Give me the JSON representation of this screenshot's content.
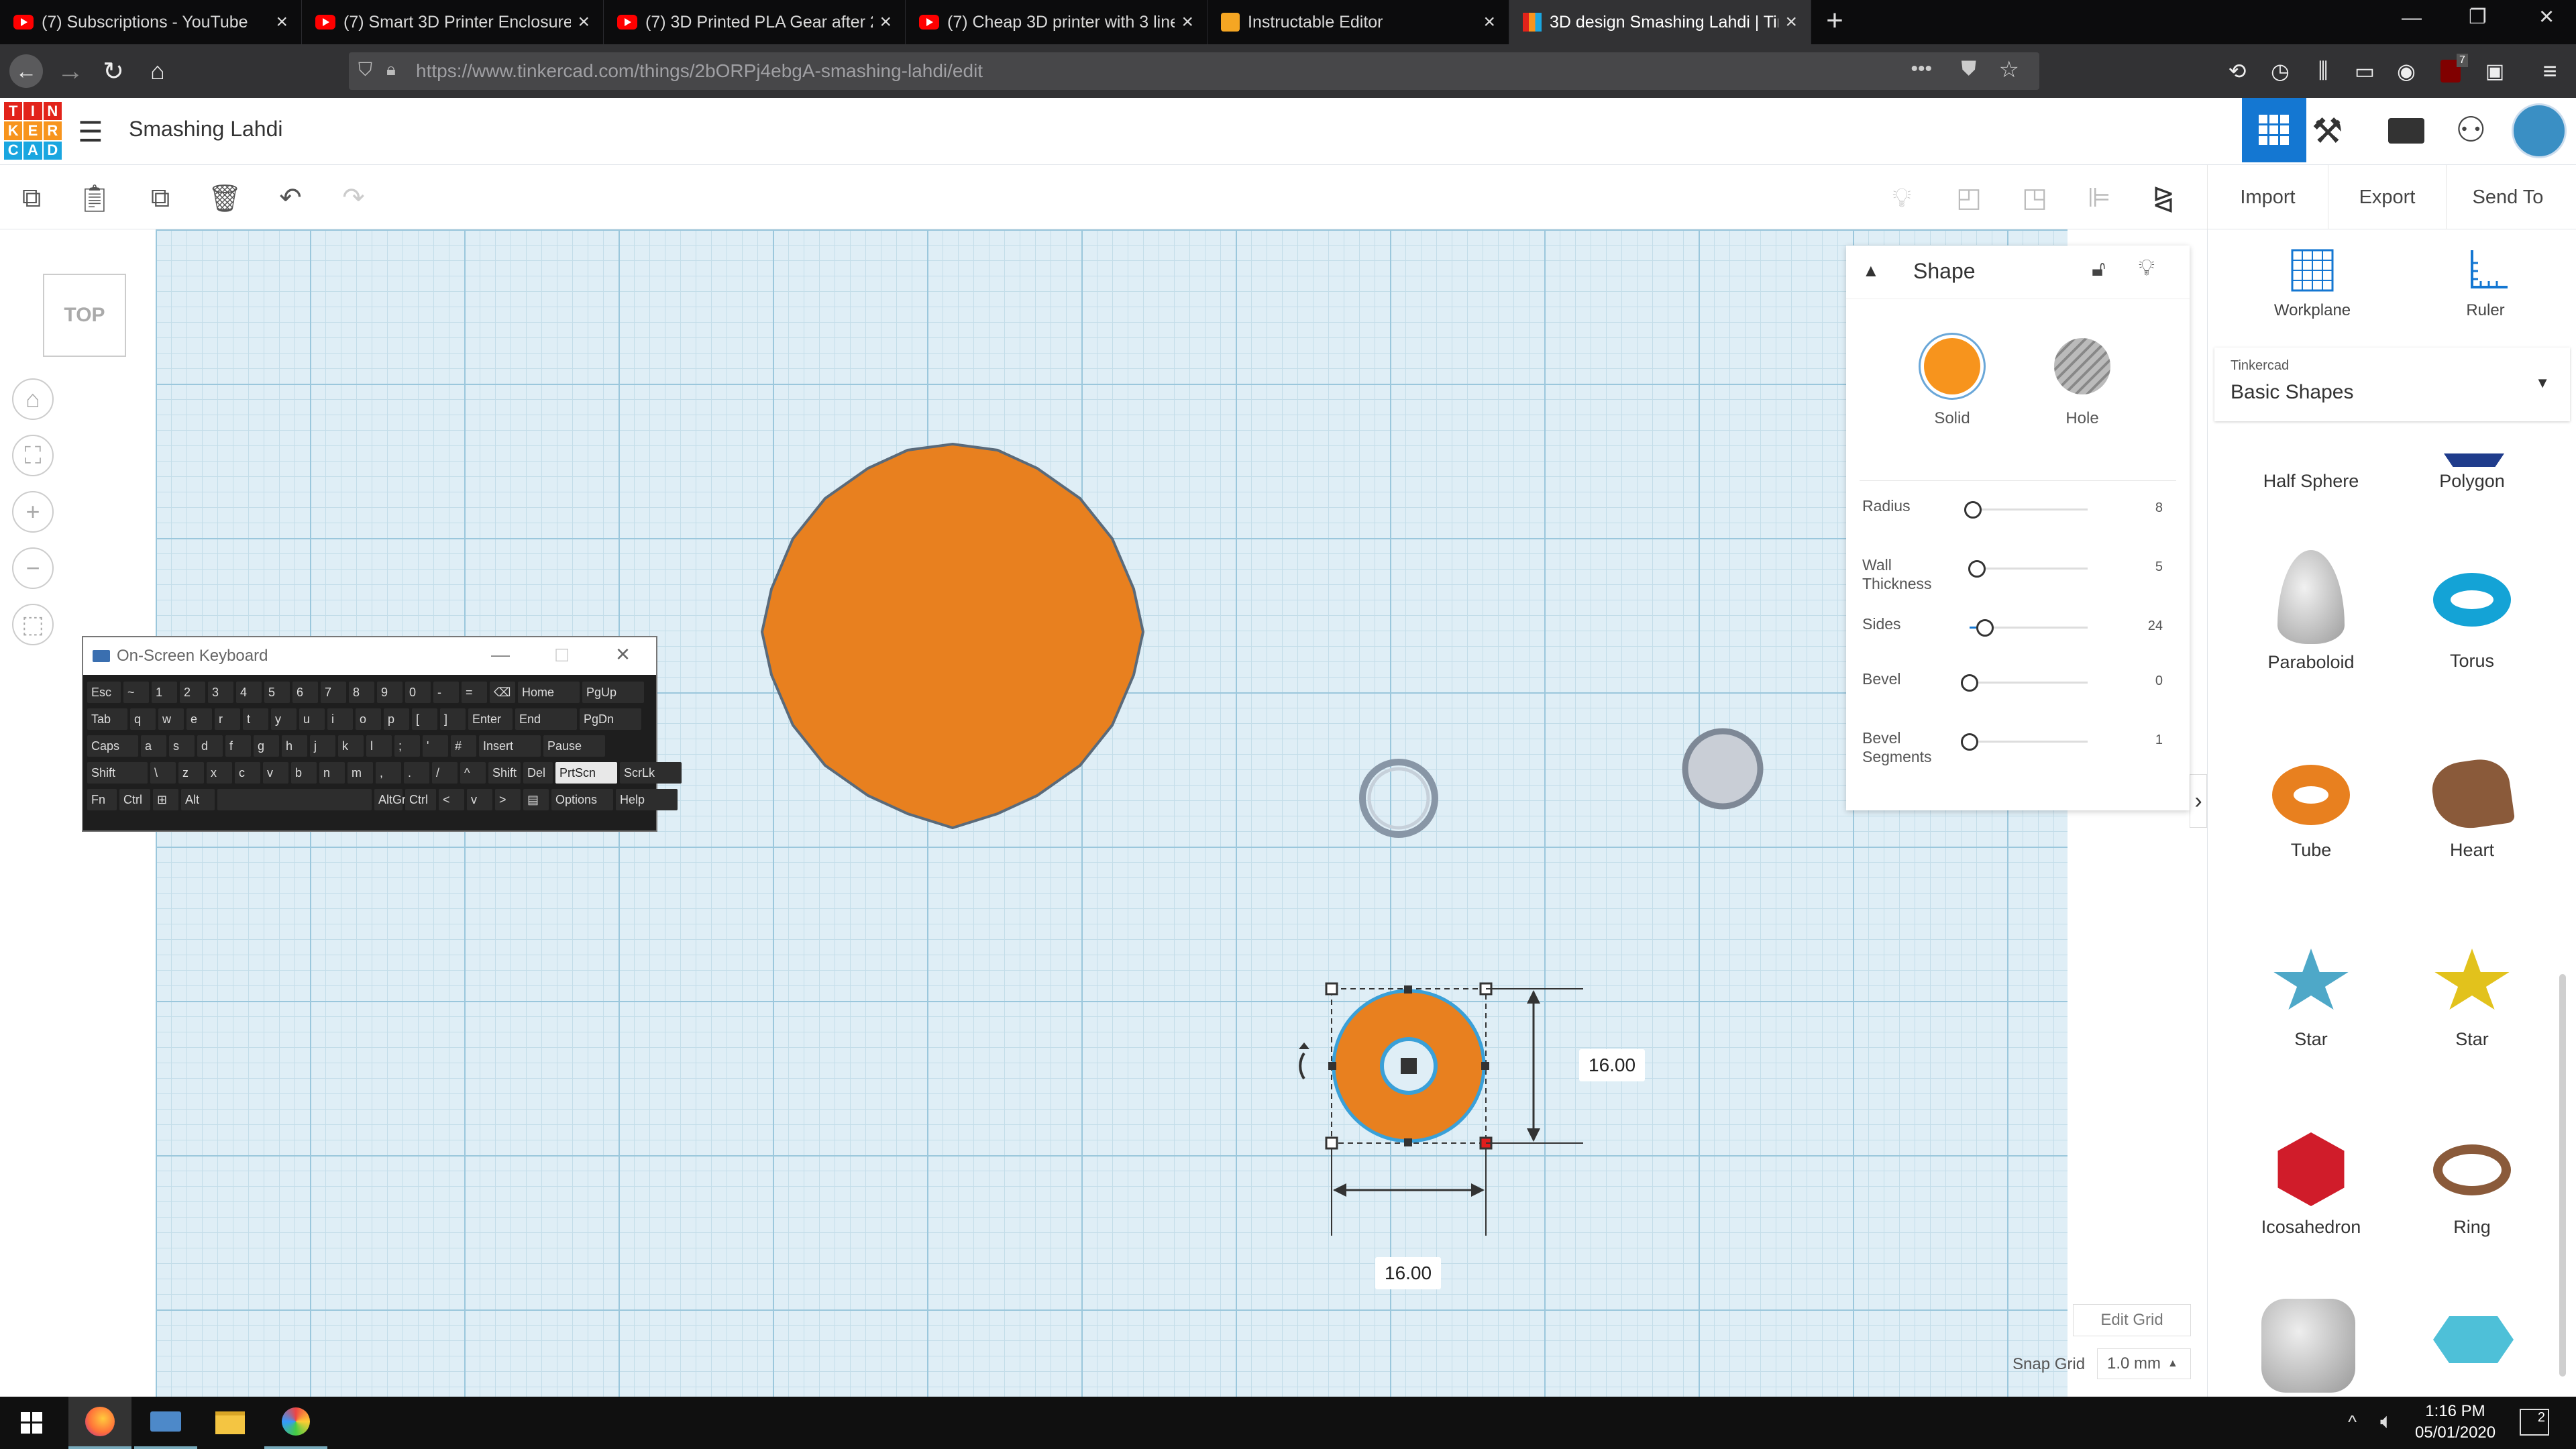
{
  "browser": {
    "tabs": [
      {
        "title": "(7) Subscriptions - YouTube",
        "favicon": "youtube-icon"
      },
      {
        "title": "(7) Smart 3D Printer Enclosure",
        "favicon": "youtube-icon"
      },
      {
        "title": "(7) 3D Printed PLA Gear after 2",
        "favicon": "youtube-icon"
      },
      {
        "title": "(7) Cheap 3D printer with 3 line",
        "favicon": "youtube-icon"
      },
      {
        "title": "Instructable Editor",
        "favicon": "instructables-icon"
      },
      {
        "title": "3D design Smashing Lahdi | Tin",
        "favicon": "tinkercad-icon"
      }
    ],
    "url": "https://www.tinkercad.com/things/2bORPj4ebgA-smashing-lahdi/edit",
    "badge_count": "7"
  },
  "app": {
    "logo_letters": [
      "T",
      "I",
      "N",
      "K",
      "E",
      "R",
      "C",
      "A",
      "D"
    ],
    "design_title": "Smashing Lahdi",
    "toolbar": {
      "import": "Import",
      "export": "Export",
      "send_to": "Send To"
    }
  },
  "workspace": {
    "view_cube": "TOP",
    "dimension_width": "16.00",
    "dimension_height": "16.00",
    "edit_grid": "Edit Grid",
    "snap_grid_label": "Snap Grid",
    "snap_grid_value": "1.0 mm"
  },
  "osk": {
    "title": "On-Screen Keyboard",
    "rows": [
      [
        "Esc",
        "~",
        "1",
        "2",
        "3",
        "4",
        "5",
        "6",
        "7",
        "8",
        "9",
        "0",
        "-",
        "=",
        "⌫",
        "Home",
        "PgUp"
      ],
      [
        "Tab",
        "q",
        "w",
        "e",
        "r",
        "t",
        "y",
        "u",
        "i",
        "o",
        "p",
        "[",
        "]",
        "Enter",
        "End",
        "PgDn"
      ],
      [
        "Caps",
        "a",
        "s",
        "d",
        "f",
        "g",
        "h",
        "j",
        "k",
        "l",
        ";",
        "'",
        "#",
        "Insert",
        "Pause"
      ],
      [
        "Shift",
        "\\",
        "z",
        "x",
        "c",
        "v",
        "b",
        "n",
        "m",
        ",",
        ".",
        "/",
        "^",
        "Shift",
        "Del",
        "PrtScn",
        "ScrLk"
      ],
      [
        "Fn",
        "Ctrl",
        "⊞",
        "Alt",
        "",
        "AltGr",
        "Ctrl",
        "<",
        "v",
        ">",
        "▤",
        "Options",
        "Help"
      ]
    ]
  },
  "shape_panel": {
    "title": "Shape",
    "solid_label": "Solid",
    "hole_label": "Hole",
    "params": [
      {
        "label": "Radius",
        "value": "8",
        "level": 0.03
      },
      {
        "label": "Wall Thickness",
        "value": "5",
        "level": 0.06
      },
      {
        "label": "Sides",
        "value": "24",
        "level": 0.13
      },
      {
        "label": "Bevel",
        "value": "0",
        "level": 0.0
      },
      {
        "label": "Bevel Segments",
        "value": "1",
        "level": 0.0
      }
    ]
  },
  "sidebar": {
    "workplane": "Workplane",
    "ruler": "Ruler",
    "library_source": "Tinkercad",
    "library_name": "Basic Shapes",
    "shapes": [
      {
        "name": "Half Sphere"
      },
      {
        "name": "Polygon"
      },
      {
        "name": "Paraboloid"
      },
      {
        "name": "Torus"
      },
      {
        "name": "Tube"
      },
      {
        "name": "Heart"
      },
      {
        "name": "Star"
      },
      {
        "name": "Star"
      },
      {
        "name": "Icosahedron"
      },
      {
        "name": "Ring"
      }
    ]
  },
  "taskbar": {
    "time": "1:16 PM",
    "date": "05/01/2020",
    "notification_count": "2"
  },
  "colors": {
    "orange": "#e8801f",
    "workplane_blue": "#dfeef6",
    "accent_blue": "#1477d2"
  }
}
